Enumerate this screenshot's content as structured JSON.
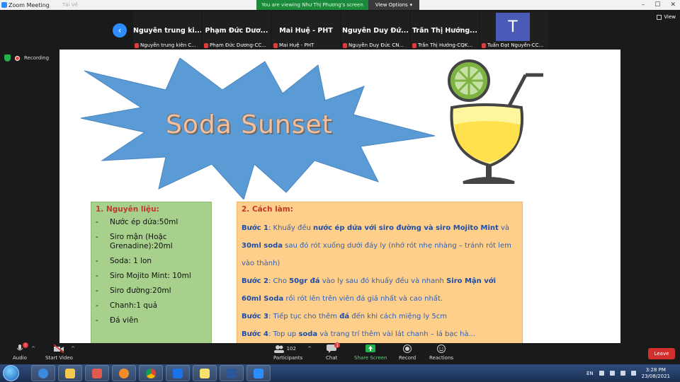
{
  "window": {
    "title": "Zoom Meeting",
    "ghost_tab": "Tải Về"
  },
  "banner": {
    "viewing_text": "You are viewing Như Thị Phương's screen",
    "view_options": "View Options"
  },
  "gallery": {
    "tiles": [
      {
        "big": "Nguyễn trung ki...",
        "small": "Nguyễn trung kiên C..."
      },
      {
        "big": "Phạm Đức Dươ...",
        "small": "Phạm Đức Dương-CC..."
      },
      {
        "big": "Mai Huệ - PHT",
        "small": "Mai Huệ - PHT"
      },
      {
        "big": "Nguyễn Duy Đứ...",
        "small": "Nguyễn Duy Đức CN..."
      },
      {
        "big": "Trần Thị Hướng...",
        "small": "Trần Thị Hướng-CQK..."
      },
      {
        "avatar": "T",
        "small": "Tuấn Đạt Nguyễn-CC..."
      }
    ],
    "view_label": "View"
  },
  "status": {
    "recording_label": "Recording"
  },
  "slide": {
    "title": "Soda Sunset",
    "ingredients": {
      "heading": "1. Nguyên liệu:",
      "items": [
        "Nước ép dứa:50ml",
        "Siro mận (Hoặc Grenadine):20ml",
        "Soda: 1 lon",
        "Siro Mojito Mint: 10ml",
        "Siro đường:20ml",
        "Chanh:1 quả",
        "Đá viên"
      ]
    },
    "method": {
      "heading": "2. Cách làm:",
      "s1": {
        "label": "Bước 1",
        "t1": ": Khuấy đều ",
        "b1": "nước ép dứa với siro đường và siro Mojito Mint",
        "t2": " và ",
        "b2": "30ml soda",
        "t3": " sau đó rót xuống dưới đáy ly (nhớ rót nhẹ nhàng – tránh rót lem vào thành)"
      },
      "s2": {
        "label": "Bước 2",
        "t1": ": Cho ",
        "b1": "50gr đá",
        "t2": " vào ly sau đó khuấy đều và nhanh ",
        "b2": "Siro Mận với 60ml Soda",
        "t3": " rồi rót lên trên viên đá giả nhất và cao nhất."
      },
      "s3": {
        "label": "Bước 3",
        "t1": ": Tiếp tục cho thêm ",
        "b1": "đá",
        "t2": " đến khi cách miệng ly 5cm"
      },
      "s4": {
        "label": "Bước 4",
        "t1": ": Top up ",
        "b1": "soda",
        "t2": " và trang trí thêm vài lát chanh – lá bạc hà…"
      }
    }
  },
  "toolbar": {
    "audio": "Audio",
    "audio_badge": "!",
    "video": "Start Video",
    "participants": "Participants",
    "participants_count": "102",
    "chat": "Chat",
    "chat_badge": "1",
    "share": "Share Screen",
    "record": "Record",
    "reactions": "Reactions",
    "leave": "Leave"
  },
  "taskbar": {
    "lang": "EN",
    "time": "3:28 PM",
    "date": "23/08/2021"
  },
  "colors": {
    "accent": "#2d8cff",
    "share_green": "#1c8a3c",
    "leave_red": "#d32f2f",
    "ingredients_bg": "#a7d08c",
    "method_bg": "#fdcf8a",
    "starburst": "#5b9bd5"
  }
}
